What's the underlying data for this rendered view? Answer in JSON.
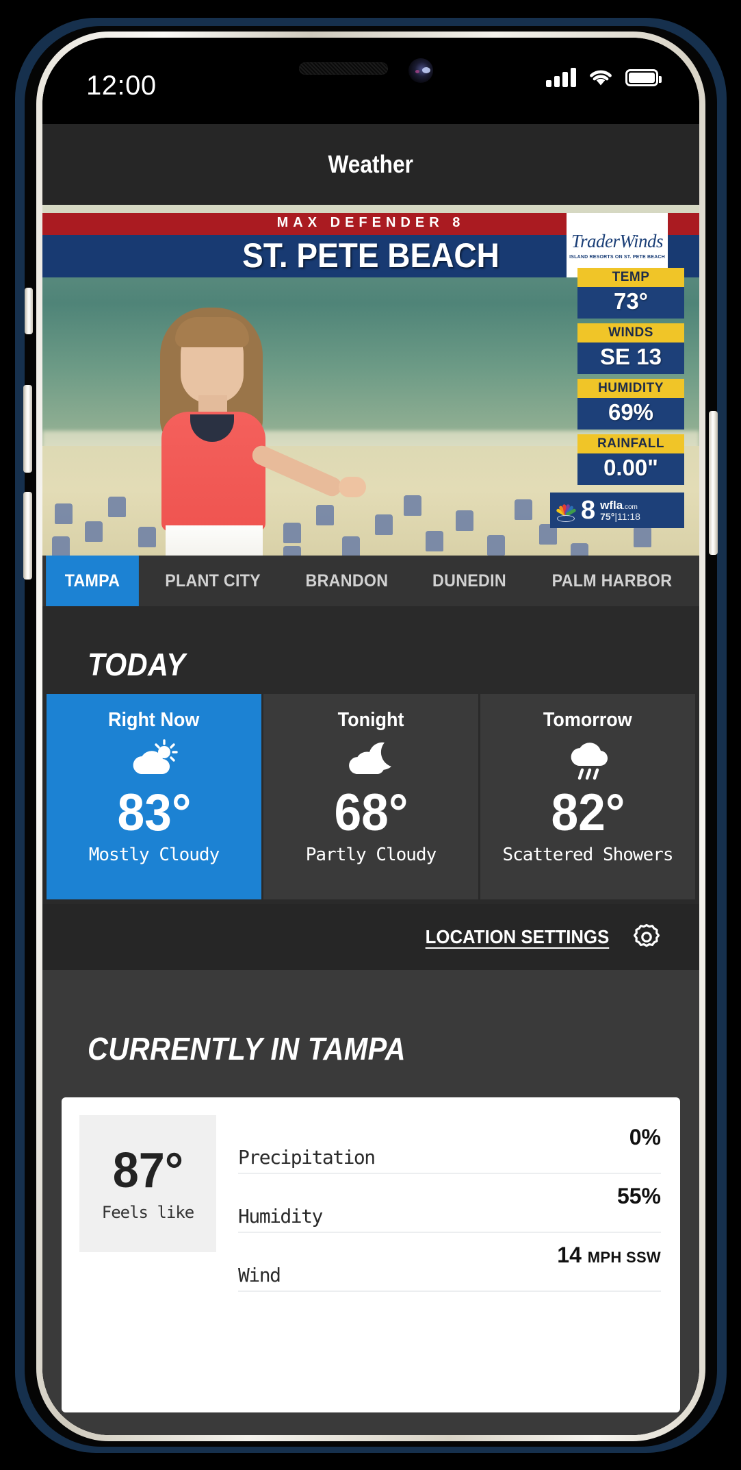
{
  "status_bar": {
    "time": "12:00",
    "signal_icon": "cellular-signal-icon",
    "wifi_icon": "wifi-icon",
    "battery_icon": "battery-icon"
  },
  "header": {
    "title": "Weather"
  },
  "video": {
    "kicker": "MAX DEFENDER 8",
    "city": "ST. PETE BEACH",
    "sponsor_logo": {
      "name": "TraderWinds",
      "tagline": "ISLAND RESORTS ON ST. PETE BEACH"
    },
    "readouts": [
      {
        "label": "TEMP",
        "value": "73°"
      },
      {
        "label": "WINDS",
        "value": "SE 13"
      },
      {
        "label": "HUMIDITY",
        "value": "69%"
      },
      {
        "label": "RAINFALL",
        "value": "0.00\""
      }
    ],
    "station_bug": {
      "channel": "8",
      "site": "wfla",
      "domain": ".com",
      "temp": "75°",
      "separator": "|",
      "time": "11:18"
    }
  },
  "tabs": [
    {
      "label": "TAMPA",
      "active": true
    },
    {
      "label": "PLANT CITY",
      "active": false
    },
    {
      "label": "BRANDON",
      "active": false
    },
    {
      "label": "DUNEDIN",
      "active": false
    },
    {
      "label": "PALM HARBOR",
      "active": false
    }
  ],
  "today": {
    "title": "TODAY",
    "cards": [
      {
        "title": "Right Now",
        "temp": "83°",
        "desc": "Mostly Cloudy",
        "icon": "sun-behind-cloud-icon",
        "active": true
      },
      {
        "title": "Tonight",
        "temp": "68°",
        "desc": "Partly Cloudy",
        "icon": "moon-behind-cloud-icon",
        "active": false
      },
      {
        "title": "Tomorrow",
        "temp": "82°",
        "desc": "Scattered Showers",
        "icon": "cloud-rain-icon",
        "active": false
      }
    ]
  },
  "location_settings": {
    "label": "LOCATION SETTINGS",
    "icon": "gear-icon"
  },
  "currently": {
    "title": "CURRENTLY IN TAMPA",
    "feels_like": {
      "temp": "87°",
      "label": "Feels like"
    },
    "rows": [
      {
        "label": "Precipitation",
        "value": "0%",
        "unit": ""
      },
      {
        "label": "Humidity",
        "value": "55%",
        "unit": ""
      },
      {
        "label": "Wind",
        "value": "14",
        "unit": "MPH SSW"
      }
    ]
  },
  "colors": {
    "accent_blue": "#1c82d3",
    "header_dark": "#262626",
    "panel_dark": "#3a3a3a",
    "banner_red": "#aa1b21",
    "banner_blue": "#183a72",
    "readout_yellow": "#f0c528"
  }
}
